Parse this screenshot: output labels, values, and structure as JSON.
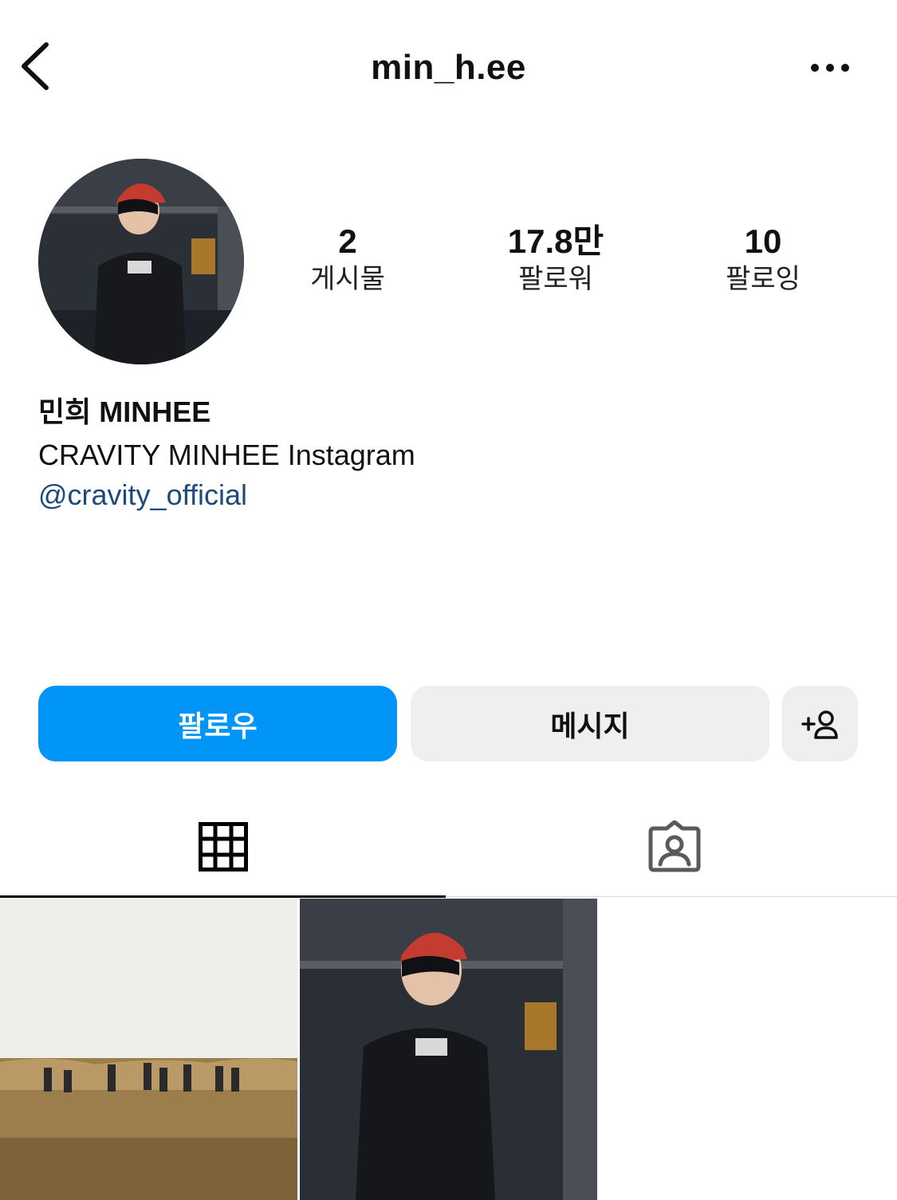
{
  "header": {
    "username": "min_h.ee",
    "back_icon": "chevron-left-icon",
    "more_icon": "more-horizontal-icon"
  },
  "profile": {
    "stats": [
      {
        "value": "2",
        "label": "게시물"
      },
      {
        "value": "17.8만",
        "label": "팔로워"
      },
      {
        "value": "10",
        "label": "팔로잉"
      }
    ],
    "display_name": "민희 MINHEE",
    "bio": "CRAVITY MINHEE Instagram",
    "mention": "@cravity_official"
  },
  "actions": {
    "follow_label": "팔로우",
    "message_label": "메시지",
    "add_user_icon": "add-person-icon"
  },
  "tabs": [
    {
      "icon": "grid-icon",
      "active": true
    },
    {
      "icon": "tagged-person-icon",
      "active": false
    }
  ],
  "colors": {
    "follow_button": "#0095f6",
    "secondary_button": "#efefef",
    "mention_link": "#1d4a7a"
  }
}
